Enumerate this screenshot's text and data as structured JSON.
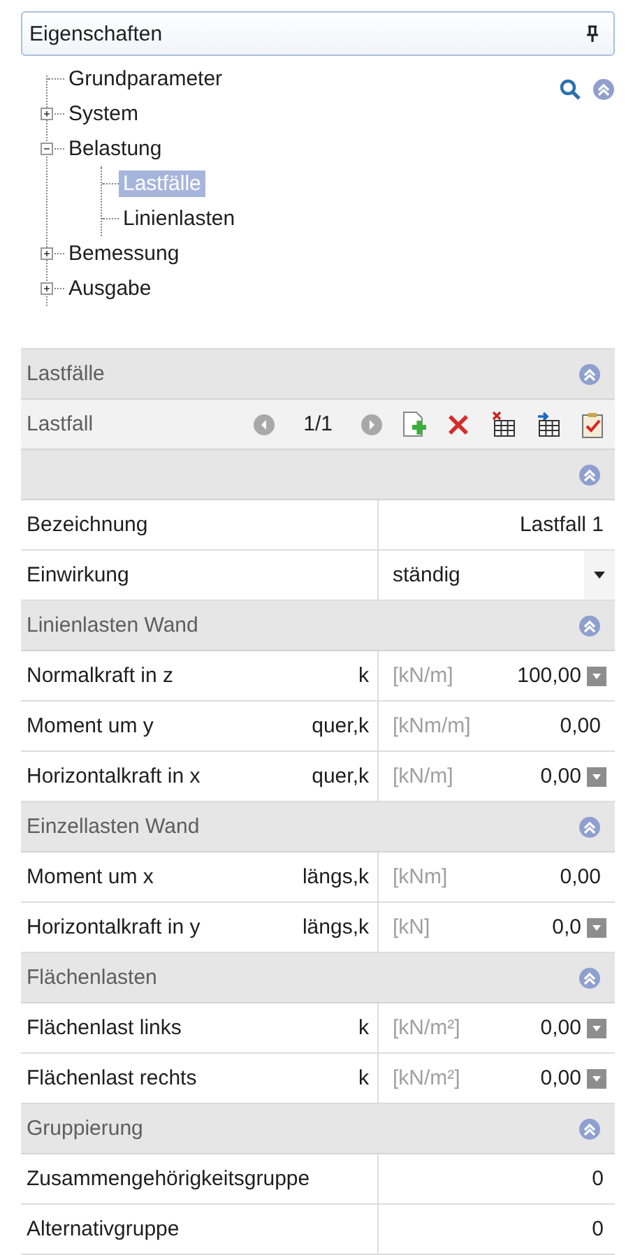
{
  "panel": {
    "title": "Eigenschaften"
  },
  "tree": [
    {
      "label": "Grundparameter",
      "selected": false
    },
    {
      "label": "System",
      "selected": false,
      "expanded": false
    },
    {
      "label": "Belastung",
      "selected": false,
      "expanded": true,
      "children": [
        {
          "label": "Lastfälle",
          "selected": true
        },
        {
          "label": "Linienlasten",
          "selected": false
        }
      ]
    },
    {
      "label": "Bemessung",
      "selected": false,
      "expanded": false
    },
    {
      "label": "Ausgabe",
      "selected": false,
      "expanded": false
    }
  ],
  "header": {
    "title": "Lastfälle"
  },
  "navigator": {
    "label": "Lastfall",
    "counter": "1/1"
  },
  "sections": [
    {
      "rows": [
        {
          "kind": "text",
          "label": "Bezeichnung",
          "value": "Lastfall 1"
        },
        {
          "kind": "dropdown",
          "label": "Einwirkung",
          "value": "ständig"
        }
      ]
    },
    {
      "title": "Linienlasten Wand",
      "rows": [
        {
          "kind": "quantity",
          "label": "Normalkraft in z",
          "index": "k",
          "unit": "[kN/m]",
          "value": "100,00",
          "picker": true
        },
        {
          "kind": "quantity",
          "label": "Moment um y",
          "index": "quer,k",
          "unit": "[kNm/m]",
          "value": "0,00",
          "picker": false
        },
        {
          "kind": "quantity",
          "label": "Horizontalkraft in x",
          "index": "quer,k",
          "unit": "[kN/m]",
          "value": "0,00",
          "picker": true
        }
      ]
    },
    {
      "title": "Einzellasten Wand",
      "rows": [
        {
          "kind": "quantity",
          "label": "Moment um x",
          "index": "längs,k",
          "unit": "[kNm]",
          "value": "0,00",
          "picker": false
        },
        {
          "kind": "quantity",
          "label": "Horizontalkraft in y",
          "index": "längs,k",
          "unit": "[kN]",
          "value": "0,0",
          "picker": true
        }
      ]
    },
    {
      "title": "Flächenlasten",
      "rows": [
        {
          "kind": "quantity",
          "label": "Flächenlast links",
          "index": "k",
          "unit": "[kN/m²]",
          "value": "0,00",
          "picker": true
        },
        {
          "kind": "quantity",
          "label": "Flächenlast rechts",
          "index": "k",
          "unit": "[kN/m²]",
          "value": "0,00",
          "picker": true
        }
      ]
    },
    {
      "title": "Gruppierung",
      "rows": [
        {
          "kind": "text",
          "label": "Zusammengehörigkeitsgruppe",
          "value": "0"
        },
        {
          "kind": "text",
          "label": "Alternativgruppe",
          "value": "0"
        }
      ]
    }
  ]
}
